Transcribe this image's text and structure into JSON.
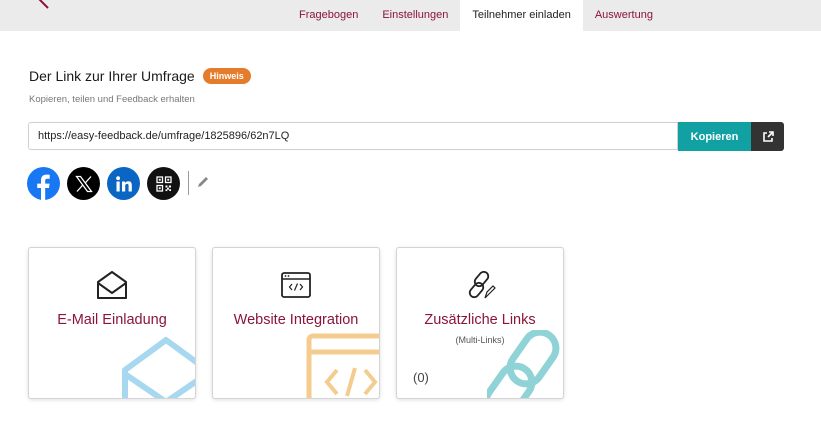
{
  "nav": {
    "tabs": [
      {
        "label": "Fragebogen"
      },
      {
        "label": "Einstellungen"
      },
      {
        "label": "Teilnehmer einladen"
      },
      {
        "label": "Auswertung"
      }
    ],
    "active_tab": "Teilnehmer einladen"
  },
  "link_section": {
    "title": "Der Link zur Ihrer Umfrage",
    "badge": "Hinweis",
    "subtitle": "Kopieren, teilen und Feedback erhalten",
    "url": "https://easy-feedback.de/umfrage/1825896/62n7LQ",
    "copy_label": "Kopieren"
  },
  "share_icons": [
    "facebook-icon",
    "x-icon",
    "linkedin-icon",
    "qr-code-icon",
    "pencil-icon"
  ],
  "cards": [
    {
      "title": "E-Mail Einladung",
      "icon": "envelope-open-icon"
    },
    {
      "title": "Website Integration",
      "icon": "code-window-icon"
    },
    {
      "title": "Zusätzliche Links",
      "subtitle": "(Multi-Links)",
      "count": "(0)",
      "icon": "link-icon"
    }
  ],
  "colors": {
    "accent": "#8b1538",
    "copy_button": "#12a1a3",
    "badge": "#e57c2c",
    "email_watermark": "#a8d8f0",
    "website_watermark": "#f5cc8f",
    "links_watermark": "#8fd3d6"
  }
}
